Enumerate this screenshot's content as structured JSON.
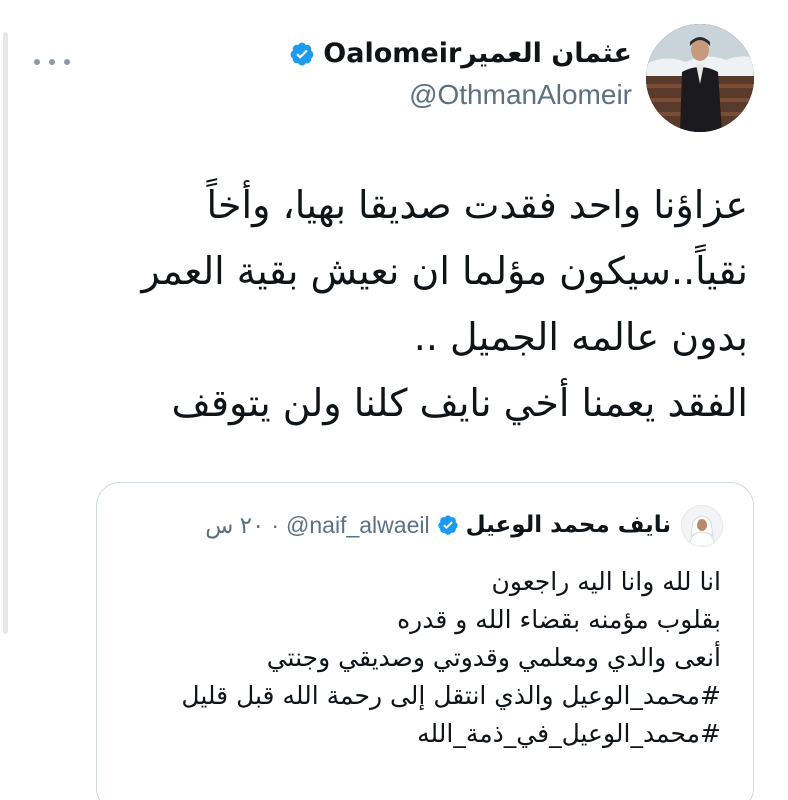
{
  "tweet": {
    "author": {
      "name": "عثمان العميرOalomeir",
      "handle": "@OthmanAlomeir",
      "verified": true
    },
    "more_icon": "more-horizontal-icon",
    "text_lines": [
      "عزاؤنا واحد فقدت صديقا بهيا، وأخاً",
      "نقياً..سيكون مؤلما ان نعيش بقية العمر",
      "بدون عالمه الجميل ..",
      "الفقد يعمنا أخي نايف كلنا ولن يتوقف"
    ]
  },
  "quoted_tweet": {
    "author": {
      "name": "نايف محمد الوعيل",
      "handle": "@naif_alwaeil",
      "verified": true
    },
    "separator": "·",
    "time": "٢٠ س",
    "text_lines": [
      "انا لله وانا اليه راجعون",
      "بقلوب مؤمنه بقضاء الله و قدره",
      "أنعى والدي ومعلمي وقدوتي وصديقي وجنتي",
      "#محمد_الوعيل والذي انتقل إلى رحمة الله قبل قليل",
      "#محمد_الوعيل_في_ذمة_الله"
    ]
  },
  "colors": {
    "verified_blue": "#1d9bf0",
    "secondary_text": "#5b7083",
    "border": "#cfd9de",
    "text": "#0f1419"
  }
}
